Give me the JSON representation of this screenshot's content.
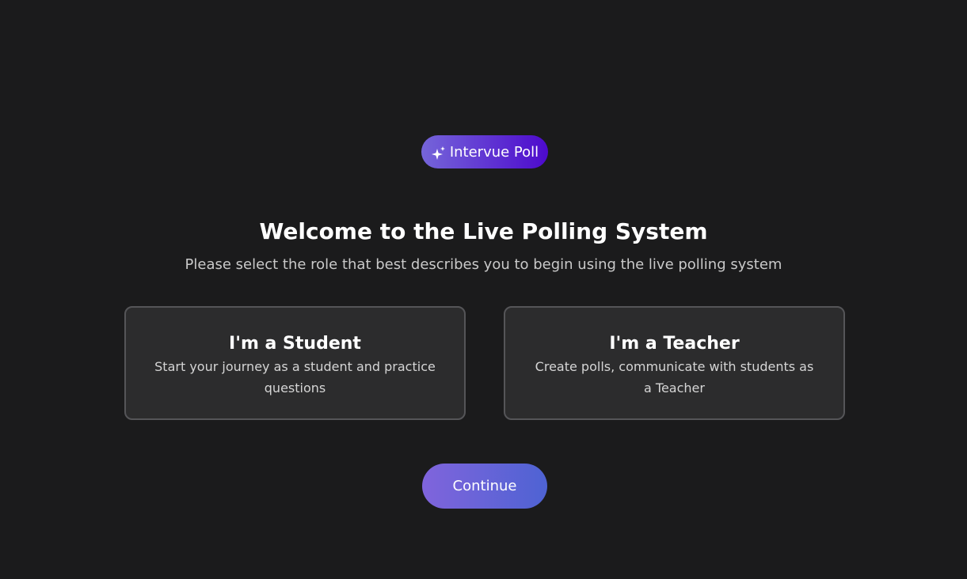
{
  "badge": {
    "label": "Intervue Poll",
    "icon": "sparkle-icon"
  },
  "heading": {
    "prefix": "Welcome to the",
    "highlight": "Live Polling System",
    "subtitle": "Please select the role that best describes you to begin using the live polling system"
  },
  "roles": [
    {
      "title": "I'm a Student",
      "description": "Start your journey as a student and practice questions"
    },
    {
      "title": "I'm a Teacher",
      "description": "Create polls, communicate with students as a Teacher"
    }
  ],
  "actions": {
    "continue_label": "Continue"
  },
  "colors": {
    "background": "#1b1b1c",
    "card_background": "#2c2c2d",
    "card_border": "#555558",
    "badge_gradient_start": "#7565d9",
    "badge_gradient_end": "#4d0acd",
    "button_gradient_start": "#8064dc",
    "button_gradient_end": "#4e63d3"
  }
}
